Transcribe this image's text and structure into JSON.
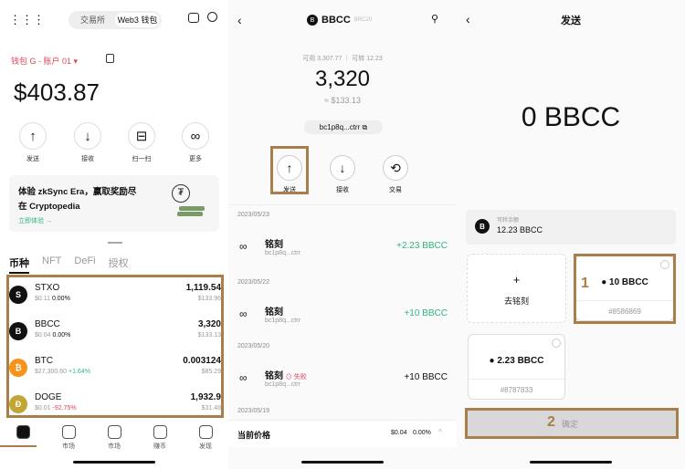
{
  "p1": {
    "tabs": [
      "交易所",
      "Web3 钱包"
    ],
    "account": "钱包 G - 账户 01 ▾",
    "total": "$403.87",
    "actions": [
      "发送",
      "接收",
      "扫一扫",
      "更多"
    ],
    "banner": {
      "title_line1": "体验 zkSync Era，赢取奖励尽",
      "title_line2": "在 Cryptopedia",
      "link": "立即体验 →"
    },
    "asset_tabs": [
      "币种",
      "NFT",
      "DeFi",
      "授权"
    ],
    "assets": [
      {
        "logo": "S",
        "name": "STXO",
        "price": "$0.11",
        "change": "0.00%",
        "balance": "1,119.54",
        "value": "$133.96",
        "color": "#111111"
      },
      {
        "logo": "B",
        "name": "BBCC",
        "price": "$0.04",
        "change": "0.00%",
        "balance": "3,320",
        "value": "$133.13",
        "color": "#111111"
      },
      {
        "logo": "₿",
        "name": "BTC",
        "price": "$27,300.60",
        "change": "+1.64%",
        "balance": "0.003124",
        "value": "$85.29",
        "color": "#f7931a"
      },
      {
        "logo": "Ð",
        "name": "DOGE",
        "price": "$0.01",
        "change": "-92.75%",
        "balance": "1,932.9",
        "value": "$31.48",
        "color": "#c2a633"
      }
    ],
    "nav": [
      "",
      "市场",
      "市场",
      "赚币",
      "发现"
    ]
  },
  "p2": {
    "token": "BBCC",
    "standard": "BRC20",
    "avail": "可用 3,307.77 ｜ 可转 12.23",
    "amount": "3,320",
    "fiat": "≈ $133.13",
    "address": "bc1p8q...ctrr",
    "actions": [
      "发送",
      "接收",
      "交易"
    ],
    "groups": [
      {
        "date": "2023/05/23",
        "name": "铭刻",
        "addr": "bc1p8q...ctrr",
        "value": "+2.23 BBCC",
        "status": ""
      },
      {
        "date": "2023/05/22",
        "name": "铭刻",
        "addr": "bc1p8q...ctrr",
        "value": "+10 BBCC",
        "status": ""
      },
      {
        "date": "2023/05/20",
        "name": "铭刻",
        "addr": "bc1p8q...ctrr",
        "value": "+10 BBCC",
        "status": "⊙ 失败"
      }
    ],
    "last_date": "2023/05/19",
    "price_label": "当前价格",
    "price_value": "$0.04",
    "price_change": "0.00%"
  },
  "p3": {
    "title": "发送",
    "amount": "0 BBCC",
    "bal_label": "可转余额",
    "bal_value": "12.23 BBCC",
    "plus": "+",
    "inscribe": "去铭刻",
    "card1_value": "10 BBCC",
    "card1_id": "#8586869",
    "card2_value": "2.23 BBCC",
    "card2_id": "#8787833",
    "step1": "1",
    "step2": "2",
    "confirm": "确定"
  }
}
